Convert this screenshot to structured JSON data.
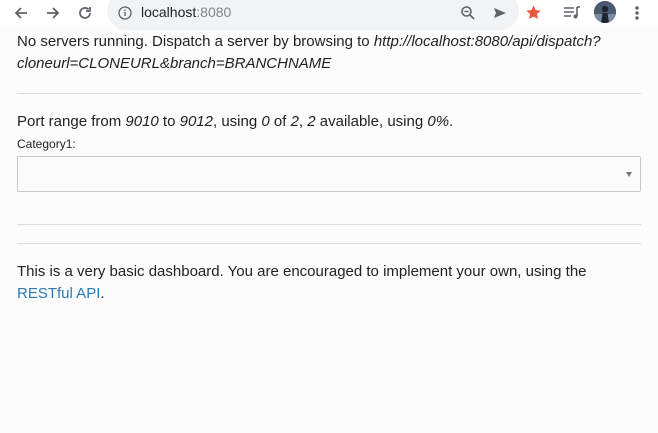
{
  "browser": {
    "url_host": "localhost",
    "url_port": ":8080",
    "icons": [
      "back-icon",
      "forward-icon",
      "reload-icon",
      "site-info-icon",
      "zoom-out-icon",
      "send-icon",
      "bookmark-star-icon",
      "media-queue-icon",
      "profile-avatar",
      "menu-icon"
    ],
    "accent_star": "#e8593a"
  },
  "servers": {
    "lead": "No servers running. Dispatch a server by browsing to ",
    "dispatch_url": "http://localhost:8080/api/dispatch?cloneurl=CLONEURL&branch=BRANCHNAME"
  },
  "ports": {
    "t1": "Port range from ",
    "from": "9010",
    "t2": " to ",
    "to": "9012",
    "t3": ", using ",
    "used": "0",
    "t4": " of ",
    "total": "2",
    "t5": ", ",
    "available": "2",
    "t6": " available, using ",
    "percent": "0%",
    "t7": "."
  },
  "category": {
    "label": "Category1:",
    "selected": ""
  },
  "footer": {
    "text": "This is a very basic dashboard. You are encouraged to implement your own, using the ",
    "link": "RESTful API",
    "end": "."
  },
  "colors": {
    "link": "#2a7ab5",
    "divider": "#dcdcdc"
  }
}
